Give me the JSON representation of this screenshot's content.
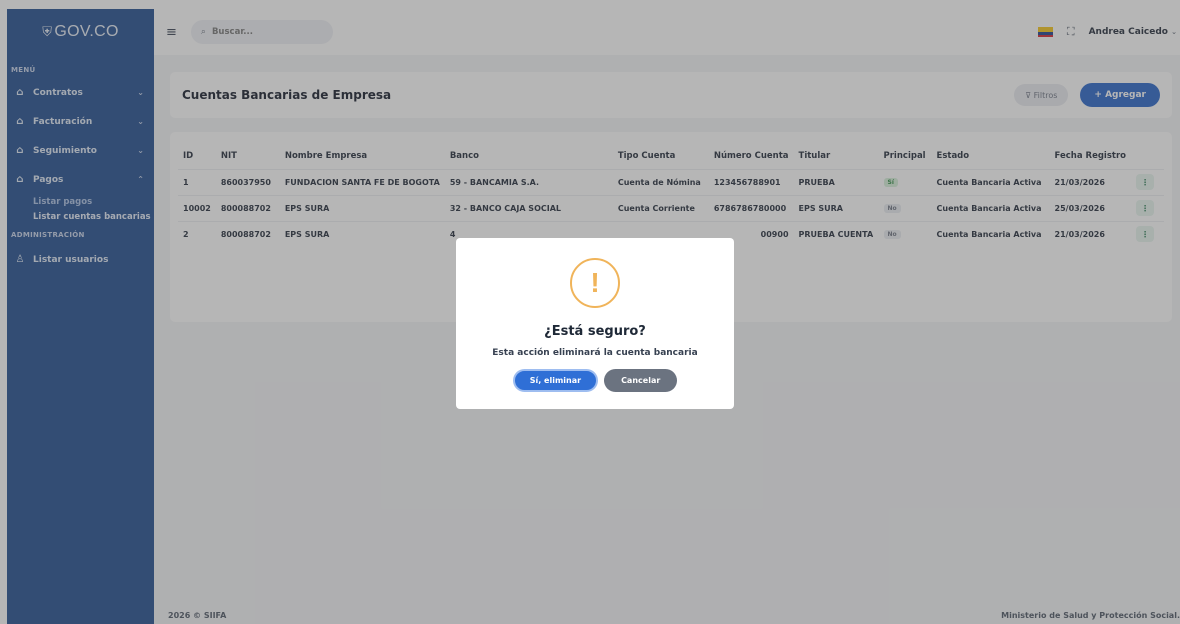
{
  "brand": {
    "logo_text": "GOV.CO"
  },
  "sidebar": {
    "section_menu": "MENÚ",
    "items": [
      {
        "label": "Contratos"
      },
      {
        "label": "Facturación"
      },
      {
        "label": "Seguimiento"
      },
      {
        "label": "Pagos"
      }
    ],
    "pagos_sub": [
      "Listar pagos",
      "Listar cuentas bancarias"
    ],
    "section_admin": "ADMINISTRACIÓN",
    "admin_items": [
      {
        "label": "Listar usuarios"
      }
    ]
  },
  "topbar": {
    "search_placeholder": "Buscar...",
    "user_name": "Andrea Caicedo"
  },
  "page": {
    "title": "Cuentas Bancarias de Empresa",
    "filter_label": "Filtros",
    "add_label": "+ Agregar"
  },
  "table": {
    "headers": [
      "ID",
      "NIT",
      "Nombre Empresa",
      "Banco",
      "Tipo Cuenta",
      "Número Cuenta",
      "Titular",
      "Principal",
      "Estado",
      "Fecha Registro"
    ],
    "rows": [
      {
        "id": "1",
        "nit": "860037950",
        "empresa": "FUNDACION SANTA FE DE BOGOTA",
        "banco": "59 - BANCAMIA S.A.",
        "tipo": "Cuenta de Nómina",
        "numero": "123456788901",
        "titular": "PRUEBA",
        "principal": "Sí",
        "estado": "Cuenta Bancaria Activa",
        "fecha": "21/03/2026"
      },
      {
        "id": "10002",
        "nit": "800088702",
        "empresa": "EPS SURA",
        "banco": "32 - BANCO CAJA SOCIAL",
        "tipo": "Cuenta Corriente",
        "numero": "6786786780000",
        "titular": "EPS SURA",
        "principal": "No",
        "estado": "Cuenta Bancaria Activa",
        "fecha": "25/03/2026"
      },
      {
        "id": "2",
        "nit": "800088702",
        "empresa": "EPS SURA",
        "banco": "4",
        "tipo": "",
        "numero": "00900",
        "titular": "PRUEBA CUENTA",
        "principal": "No",
        "estado": "Cuenta Bancaria Activa",
        "fecha": "21/03/2026"
      }
    ]
  },
  "footer": {
    "left": "2026 © SIIFA",
    "right": "Ministerio de Salud y Protección Social."
  },
  "modal": {
    "icon": "!",
    "title": "¿Está seguro?",
    "text": "Esta acción eliminará la cuenta bancaria",
    "confirm_label": "Sí, eliminar",
    "cancel_label": "Cancelar"
  },
  "colors": {
    "sidebar_bg": "#1e4a8d",
    "primary": "#2563c9",
    "warning": "#f0b45a"
  }
}
